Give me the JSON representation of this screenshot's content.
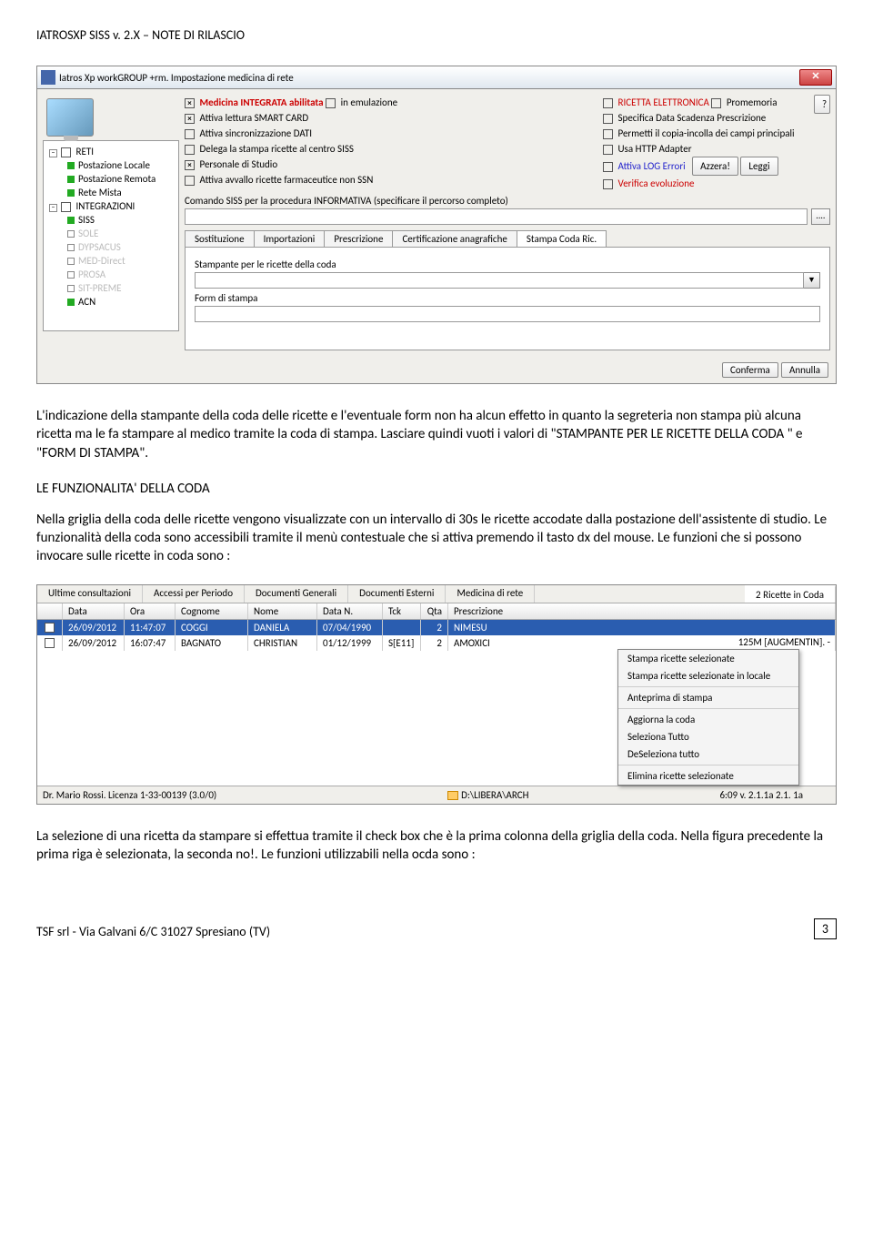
{
  "header": "IATROSXP SISS v. 2.X – NOTE DI RILASCIO",
  "dialog": {
    "title": "Iatros Xp workGROUP +rm. Impostazione medicina di rete",
    "tree": {
      "reti": "RETI",
      "items_reti": [
        "Postazione Locale",
        "Postazione Remota",
        "Rete Mista"
      ],
      "integrazioni": "INTEGRAZIONI",
      "items_int": [
        {
          "label": "SISS",
          "en": true
        },
        {
          "label": "SOLE",
          "en": false
        },
        {
          "label": "DYPSACUS",
          "en": false
        },
        {
          "label": "MED-Direct",
          "en": false
        },
        {
          "label": "PROSA",
          "en": false
        },
        {
          "label": "SIT-PREME",
          "en": false
        },
        {
          "label": "ACN",
          "en": true
        }
      ]
    },
    "mid": {
      "m0": "Medicina INTEGRATA abilitata",
      "m0b": "in emulazione",
      "m1": "Attiva lettura SMART CARD",
      "m2": "Attiva sincronizzazione DATI",
      "m3": "Delega la stampa ricette al centro SISS",
      "m4": "Personale di Studio",
      "m5": "Attiva avvallo ricette farmaceutice non SSN",
      "cmd": "Comando SISS per la procedura INFORMATIVA (specificare il percorso completo)"
    },
    "right": {
      "r0": "RICETTA ELETTRONICA",
      "r0b": "Promemoria",
      "r1": "Specifica Data Scadenza Prescrizione",
      "r2": "Permetti il copia-incolla dei campi principali",
      "r3": "Usa HTTP Adapter",
      "r4": "Attiva LOG Errori",
      "r5": "Verifica evoluzione",
      "azzera": "Azzera!",
      "leggi": "Leggi"
    },
    "tabs": [
      "Sostituzione",
      "Importazioni",
      "Prescrizione",
      "Certificazione anagrafiche",
      "Stampa Coda Ric."
    ],
    "tab_body": {
      "l1": "Stampante per le ricette della coda",
      "l2": "Form di stampa"
    },
    "conferma": "Conferma",
    "annulla": "Annulla",
    "dots": "....",
    "help": "?"
  },
  "para1": "L'indicazione della stampante della coda delle ricette e l'eventuale form non ha alcun effetto in quanto la segreteria non stampa più alcuna ricetta ma le fa stampare al medico tramite la coda di stampa. Lasciare quindi vuoti i valori di \"STAMPANTE PER LE RICETTE DELLA CODA \" e \"FORM DI STAMPA\".",
  "heading2": "LE FUNZIONALITA' DELLA CODA",
  "para2": "Nella griglia della coda delle ricette vengono visualizzate con un intervallo di 30s le ricette accodate dalla postazione dell'assistente di studio.  Le funzionalità della coda sono accessibili tramite il menù contestuale che si attiva premendo il tasto dx del mouse. Le funzioni che si possono invocare sulle ricette in coda sono :",
  "grid": {
    "tabs": [
      "Ultime consultazioni",
      "Accessi per Periodo",
      "Documenti Generali",
      "Documenti Esterni",
      "Medicina di rete",
      "2 Ricette in Coda"
    ],
    "cols": [
      "",
      "Data",
      "Ora",
      "Cognome",
      "Nome",
      "Data N.",
      "Tck",
      "Qta",
      "Prescrizione"
    ],
    "rows": [
      {
        "chk": true,
        "data": "26/09/2012",
        "ora": "11:47:07",
        "cog": "COGGI",
        "nome": "DANIELA",
        "datan": "07/04/1990",
        "tck": "",
        "qta": "2",
        "pre": "NIMESU"
      },
      {
        "chk": false,
        "data": "26/09/2012",
        "ora": "16:07:47",
        "cog": "BAGNATO",
        "nome": "CHRISTIAN",
        "datan": "01/12/1999",
        "tck": "S[E11]",
        "qta": "2",
        "pre": "AMOXICI"
      }
    ],
    "pre_tail": "125M [AUGMENTIN]. -",
    "context": [
      "Stampa ricette selezionate",
      "Stampa ricette selezionate in locale",
      "Anteprima di stampa",
      "Aggiorna la coda",
      "Seleziona Tutto",
      "DeSeleziona tutto",
      "Elimina ricette selezionate"
    ],
    "status1": "Dr. Mario Rossi. Licenza 1-33-00139 (3.0/0)",
    "status2": "D:\\LIBERA\\ARCH",
    "status3": "6:09  v. 2.1.1a  2.1. 1a"
  },
  "para3": "La selezione di una ricetta da stampare si effettua tramite il check box che è la prima colonna della griglia della coda. Nella figura precedente la prima riga è selezionata, la seconda no!. Le funzioni utilizzabili nella ocda sono :",
  "footer": "TSF srl  - Via Galvani 6/C 31027 Spresiano (TV)",
  "pagenum": "3"
}
